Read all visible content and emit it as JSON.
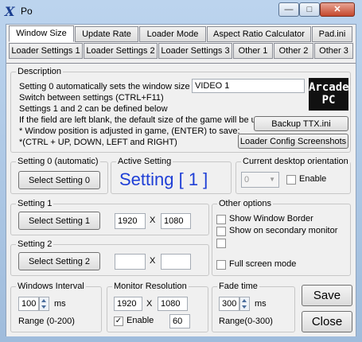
{
  "window": {
    "title": "Po",
    "app_icon": "X"
  },
  "tabs_row1": [
    "Window Size",
    "Update Rate",
    "Loader Mode",
    "Aspect Ratio Calculator",
    "Pad.ini"
  ],
  "tabs_row2": [
    "Loader Settings 1",
    "Loader Settings 2",
    "Loader Settings 3",
    "Other 1",
    "Other 2",
    "Other 3"
  ],
  "description": {
    "legend": "Description",
    "lines": [
      "Setting 0 automatically sets the window size",
      "Switch between settings (CTRL+F11)",
      "Settings 1 and 2 can be defined below",
      "If the field are left blank, the default size of the game will be used",
      "* Window position is adjusted in game, (ENTER) to save:",
      "*(CTRL + UP, DOWN, LEFT and RIGHT)"
    ],
    "video_field": "VIDEO 1",
    "logo_line1": "Arcade",
    "logo_line2": "PC",
    "backup_button": "Backup TTX.ini",
    "screenshots_button": "Loader Config Screenshots"
  },
  "setting0": {
    "legend": "Setting 0 (automatic)",
    "button": "Select Setting 0"
  },
  "active_setting": {
    "legend": "Active Setting",
    "value": "Setting [ 1 ]"
  },
  "desktop_orientation": {
    "legend": "Current desktop orientation",
    "value": "0",
    "enable_label": "Enable",
    "enabled": false
  },
  "setting1": {
    "legend": "Setting 1",
    "button": "Select Setting 1",
    "width": "1920",
    "x": "X",
    "height": "1080"
  },
  "setting2": {
    "legend": "Setting 2",
    "button": "Select Setting 2",
    "width": "",
    "x": "X",
    "height": ""
  },
  "other_options": {
    "legend": "Other options",
    "show_window_border": "Show Window Border",
    "show_secondary_monitor": "Show on secondary monitor",
    "third_label": "",
    "full_screen_mode": "Full screen mode"
  },
  "windows_interval": {
    "legend": "Windows Interval",
    "value": "100",
    "unit": "ms",
    "range": "Range (0-200)"
  },
  "monitor_resolution": {
    "legend": "Monitor Resolution",
    "width": "1920",
    "x": "X",
    "height": "1080",
    "enable_label": "Enable",
    "enabled": true,
    "refresh": "60"
  },
  "fade_time": {
    "legend": "Fade time",
    "value": "300",
    "unit": "ms",
    "range": "Range(0-300)"
  },
  "buttons": {
    "save": "Save",
    "close": "Close"
  },
  "colors": {
    "active_setting_text": "#1f3fd6",
    "close_button": "#c4472c"
  }
}
